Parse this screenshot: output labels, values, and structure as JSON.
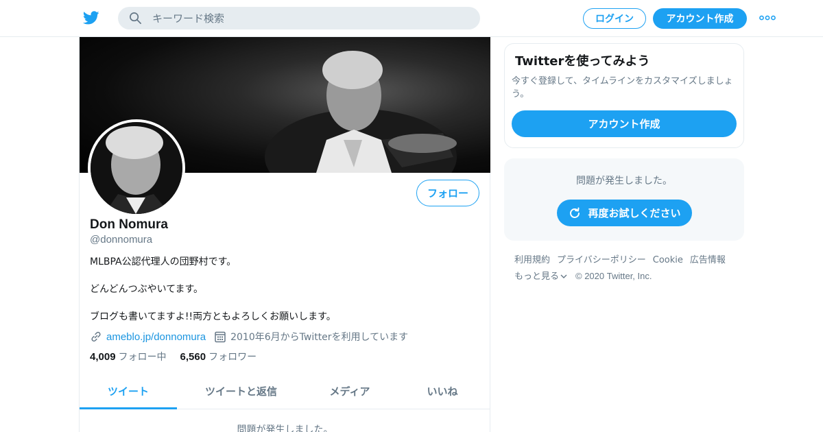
{
  "colors": {
    "accent": "#1da1f2",
    "link": "#1b95e0",
    "muted": "#657786",
    "text": "#14171a",
    "border": "#e6ecf0",
    "panel": "#f5f8fa"
  },
  "header": {
    "logo_icon": "twitter-bird-icon",
    "search_placeholder": "キーワード検索",
    "login_label": "ログイン",
    "signup_label": "アカウント作成",
    "more_icon": "more-dots-icon"
  },
  "profile": {
    "name": "Don Nomura",
    "handle": "@donnomura",
    "follow_label": "フォロー",
    "bio": [
      "MLBPA公認代理人の団野村です。",
      "どんどんつぶやいてます。",
      "ブログも書いてますよ!!両方ともよろしくお願いします。"
    ],
    "link_icon": "link-icon",
    "link": "ameblo.jp/donnomura",
    "calendar_icon": "calendar-icon",
    "joined": "2010年6月からTwitterを利用しています",
    "following_count": "4,009",
    "following_label": "フォロー中",
    "followers_count": "6,560",
    "followers_label": "フォロワー"
  },
  "tabs": [
    {
      "label": "ツイート",
      "active": true
    },
    {
      "label": "ツイートと返信",
      "active": false
    },
    {
      "label": "メディア",
      "active": false
    },
    {
      "label": "いいね",
      "active": false
    }
  ],
  "timeline_error": "問題が発生しました。",
  "sidebar": {
    "signup_card": {
      "title": "Twitterを使ってみよう",
      "text": "今すぐ登録して、タイムラインをカスタマイズしましょう。",
      "button": "アカウント作成"
    },
    "error_card": {
      "message": "問題が発生しました。",
      "retry_icon": "refresh-icon",
      "retry_label": "再度お試しください"
    },
    "footer": {
      "links": [
        "利用規約",
        "プライバシーポリシー",
        "Cookie",
        "広告情報"
      ],
      "more_label": "もっと見る",
      "copyright": "© 2020 Twitter, Inc."
    }
  }
}
